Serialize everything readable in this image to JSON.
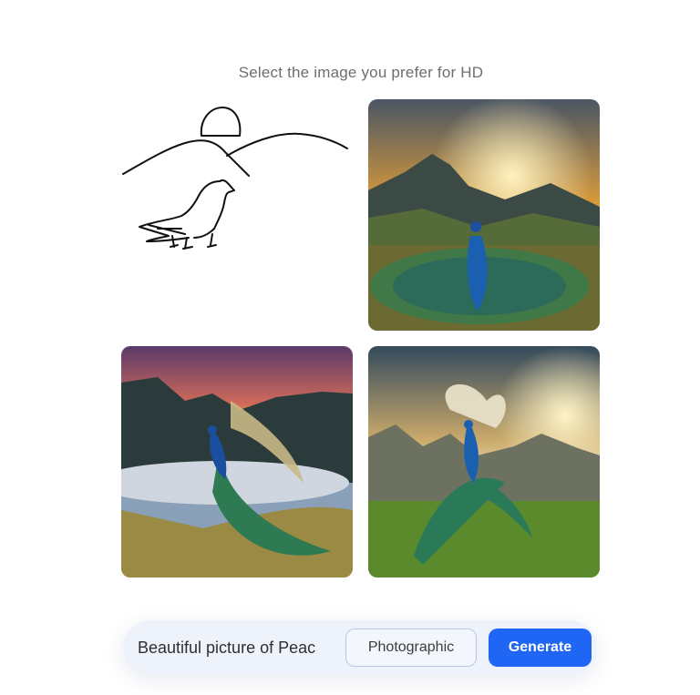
{
  "heading": "Select the image you prefer for HD",
  "images": [
    {
      "name": "sketch-image",
      "kind": "input sketch"
    },
    {
      "name": "peacock-option-1"
    },
    {
      "name": "peacock-option-2"
    },
    {
      "name": "peacock-option-3"
    }
  ],
  "prompt_bar": {
    "prompt_value": "Beautiful picture of Peac",
    "style_label": "Photographic",
    "generate_label": "Generate"
  },
  "colors": {
    "accent": "#1f66f5",
    "bar_bg": "#eef2fb",
    "style_border": "#b9c6e2",
    "heading_text": "#6e6e6e"
  }
}
